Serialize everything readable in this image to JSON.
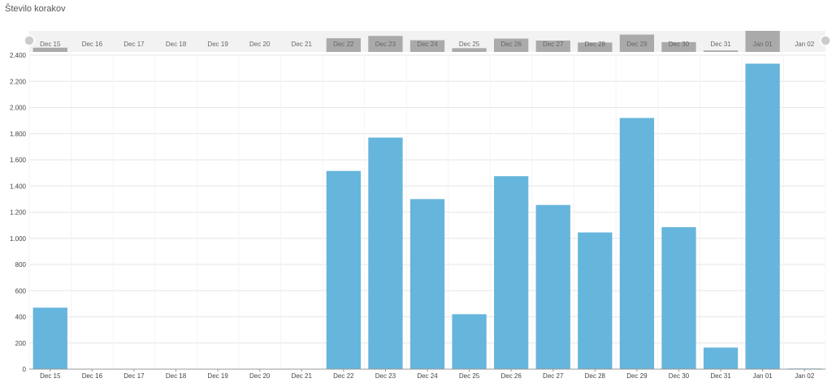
{
  "chart_data": {
    "type": "bar",
    "title": "Število korakov",
    "categories": [
      "Dec 15",
      "Dec 16",
      "Dec 17",
      "Dec 18",
      "Dec 19",
      "Dec 20",
      "Dec 21",
      "Dec 22",
      "Dec 23",
      "Dec 24",
      "Dec 25",
      "Dec 26",
      "Dec 27",
      "Dec 28",
      "Dec 29",
      "Dec 30",
      "Dec 31",
      "Jan 01",
      "Jan 02"
    ],
    "values": [
      470,
      0,
      0,
      0,
      0,
      0,
      0,
      1515,
      1770,
      1300,
      420,
      1475,
      1255,
      1045,
      1920,
      1085,
      165,
      2335,
      5
    ],
    "ylim": [
      0,
      2400
    ],
    "yticks": [
      "0",
      "200",
      "400",
      "600",
      "800",
      "1.000",
      "1.200",
      "1.400",
      "1.600",
      "1.800",
      "2.000",
      "2.200",
      "2.400"
    ],
    "ytick_values": [
      0,
      200,
      400,
      600,
      800,
      1000,
      1200,
      1400,
      1600,
      1800,
      2000,
      2200,
      2400
    ],
    "xlabel": "",
    "ylabel": "",
    "grid": true,
    "legend": "none",
    "colors": {
      "bar": "#66b5dc",
      "navigator_bar": "#aaaaaa",
      "navigator_bg": "#f2f2f2",
      "grid": "#e6e6e6",
      "handle": "#cccccc"
    }
  }
}
